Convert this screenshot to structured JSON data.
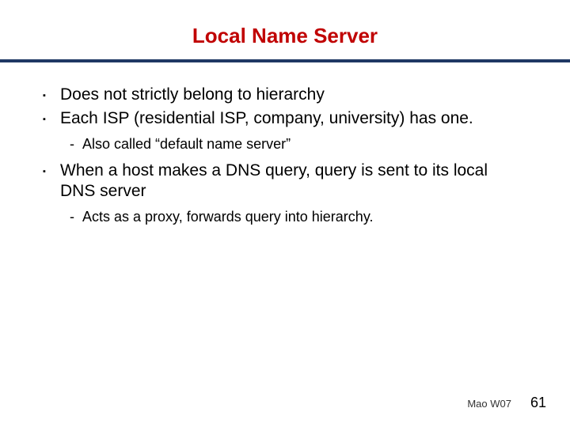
{
  "title": {
    "text": "Local Name Server",
    "color": "#c00000"
  },
  "divider": {
    "color": "#1f3864"
  },
  "bullets": {
    "b1": "Does not strictly belong to hierarchy",
    "b2": "Each ISP (residential ISP, company, university) has one.",
    "b2_sub": "Also called “default name server”",
    "b3": "When a host makes a DNS query, query is sent to its local DNS server",
    "b3_sub": "Acts as a proxy, forwards query into hierarchy."
  },
  "footer": {
    "credit": "Mao W07",
    "page": "61"
  }
}
